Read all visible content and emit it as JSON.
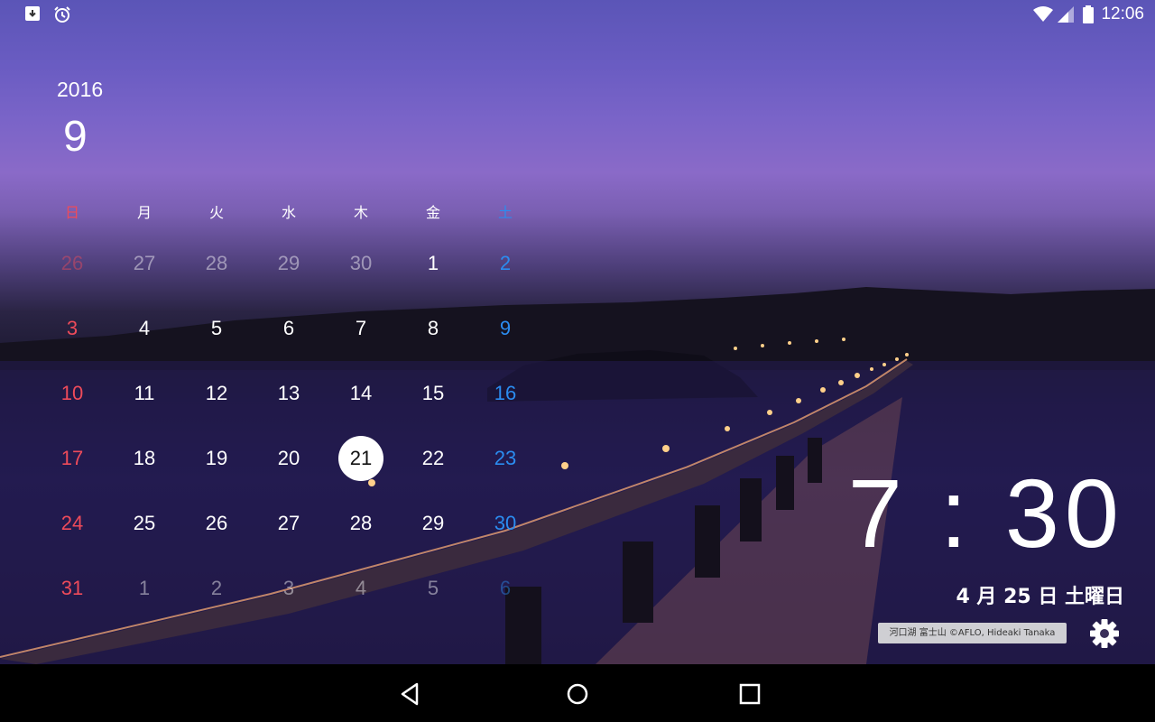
{
  "status_bar": {
    "left_icons": [
      "archive-download-icon",
      "alarm-clock-icon"
    ],
    "right_icons": [
      "wifi-icon",
      "cell-signal-icon",
      "battery-icon"
    ],
    "time": "12:06"
  },
  "calendar": {
    "year": "2016",
    "month": "9",
    "weekdays": [
      "日",
      "月",
      "火",
      "水",
      "木",
      "金",
      "土"
    ],
    "weeks": [
      [
        "26",
        "27",
        "28",
        "29",
        "30",
        "1",
        "2"
      ],
      [
        "3",
        "4",
        "5",
        "6",
        "7",
        "8",
        "9"
      ],
      [
        "10",
        "11",
        "12",
        "13",
        "14",
        "15",
        "16"
      ],
      [
        "17",
        "18",
        "19",
        "20",
        "21",
        "22",
        "23"
      ],
      [
        "24",
        "25",
        "26",
        "27",
        "28",
        "29",
        "30"
      ],
      [
        "31",
        "1",
        "2",
        "3",
        "4",
        "5",
        "6"
      ]
    ],
    "today": "21",
    "colors": {
      "sunday": "#ee4b5a",
      "saturday": "#2b8cf0"
    }
  },
  "clock": {
    "time": "7 : 30",
    "date": "4 月 25 日 土曜日"
  },
  "photo_credit": "河口湖 富士山 ©AFLO, Hideaki Tanaka",
  "nav_bar": {
    "icons": [
      "back-icon",
      "home-icon",
      "recents-icon"
    ]
  }
}
